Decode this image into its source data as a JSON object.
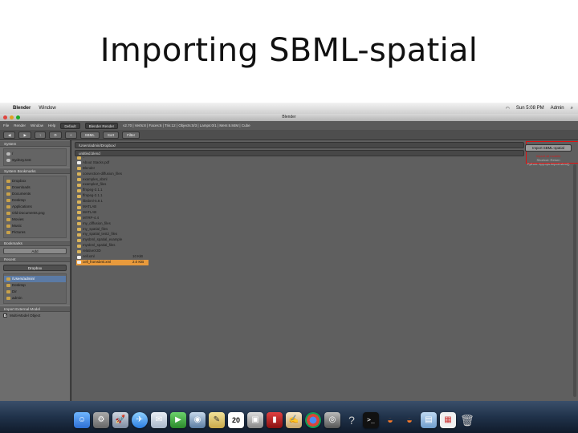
{
  "slide": {
    "title": "Importing SBML-spatial"
  },
  "menubar": {
    "apple": "",
    "app": "Blender",
    "menus": [
      "Window"
    ],
    "clock": "Sun 5:08 PM",
    "user": "Admin"
  },
  "window": {
    "title": "Blender"
  },
  "infobar": {
    "items": [
      "File",
      "Render",
      "Window",
      "Help"
    ],
    "screen": "Default",
    "engine": "Blender Render",
    "stats": "v2.70 | Verts:8 | Faces:6 | Tris:12 | Objects:0/3 | Lamps:0/1 | Mem:6.84M | Cube"
  },
  "file_browser": {
    "header": {
      "back_label": "◀",
      "fwd_label": "▶",
      "parent_label": "↑",
      "refresh_label": "⟳",
      "newdir_label": "+",
      "view_label": "SBML",
      "filter_label": "Filter",
      "sort_label": "Sort"
    },
    "directory": "/Users/admin/Dropbox/",
    "filename": "untitled.blend",
    "operator": {
      "import_label": "Import SBML-spatial",
      "cancel_label": "Cancel",
      "tip_1": "Import all models",
      "tip_2": "Shortcut: Return",
      "tip_3": "Python: bpy.ops.import.sbml()"
    },
    "files": [
      {
        "name": "..",
        "size": "",
        "type": "parent"
      },
      {
        "name": "About Stacks.pdf",
        "size": "",
        "type": "doc"
      },
      {
        "name": "Blender",
        "size": "",
        "type": "folder"
      },
      {
        "name": "convection-diffusion_files",
        "size": "",
        "type": "folder"
      },
      {
        "name": "examples_sbml",
        "size": "",
        "type": "folder"
      },
      {
        "name": "example2_files",
        "size": "",
        "type": "folder"
      },
      {
        "name": "ffmpeg-2.1.1",
        "size": "",
        "type": "folder"
      },
      {
        "name": "ffmpeg-2.1.1",
        "size": "",
        "type": "folder"
      },
      {
        "name": "libsbml-5.9.1",
        "size": "",
        "type": "folder"
      },
      {
        "name": "MATLAB",
        "size": "",
        "type": "folder"
      },
      {
        "name": "MATLAB",
        "size": "",
        "type": "folder"
      },
      {
        "name": "MTRP-4.4",
        "size": "",
        "type": "folder"
      },
      {
        "name": "my_diffusion_files",
        "size": "",
        "type": "folder"
      },
      {
        "name": "my_spatial_files",
        "size": "",
        "type": "folder"
      },
      {
        "name": "my_spatial_test2_files",
        "size": "",
        "type": "folder"
      },
      {
        "name": "mysbml_spatial_example",
        "size": "",
        "type": "folder"
      },
      {
        "name": "mysbml_spatial_files",
        "size": "",
        "type": "folder"
      },
      {
        "name": "relativeX3D",
        "size": "",
        "type": "folder"
      },
      {
        "name": "cell.xml",
        "size": "10 KiB",
        "type": "doc"
      },
      {
        "name": "cell_fromsbml.xml",
        "size": "2.0 KiB",
        "type": "doc",
        "selected": true
      }
    ]
  },
  "sidebar": {
    "system_label": "System",
    "system_items": [
      "/",
      "Sydney.test"
    ],
    "bookmarks_label": "System Bookmarks",
    "bookmark_items": [
      "Dropbox",
      "Downloads",
      "Documents",
      "Desktop",
      "Applications",
      "Movies",
      "Music",
      "Pictures"
    ],
    "bookmark_sel_extra": "Old Documents.png",
    "bookmarks2_label": "Bookmarks",
    "add_label": "Add",
    "recent_label": "Recent",
    "recent_input": "Dropbox",
    "recent_items": [
      "/Users/admin/",
      "Desktop",
      "Dir",
      "admin"
    ],
    "import_panel_label": "Import External Model",
    "checkbox_label": "Multi-Model Object",
    "checkbox_checked": "✓"
  },
  "dock": {
    "icons": [
      "finder-icon",
      "system-prefs-icon",
      "launchpad-icon",
      "safari-icon",
      "mail-icon",
      "facetime-icon",
      "photos-icon",
      "stickies-icon",
      "calendar-icon",
      "app-icon",
      "book-icon",
      "paint-icon",
      "chrome-icon",
      "photobooth-icon",
      "help-icon",
      "terminal-icon",
      "blender-icon",
      "blender2-icon",
      "folder-icon",
      "document-icon",
      "trash-icon"
    ],
    "calendar_day": "20"
  }
}
